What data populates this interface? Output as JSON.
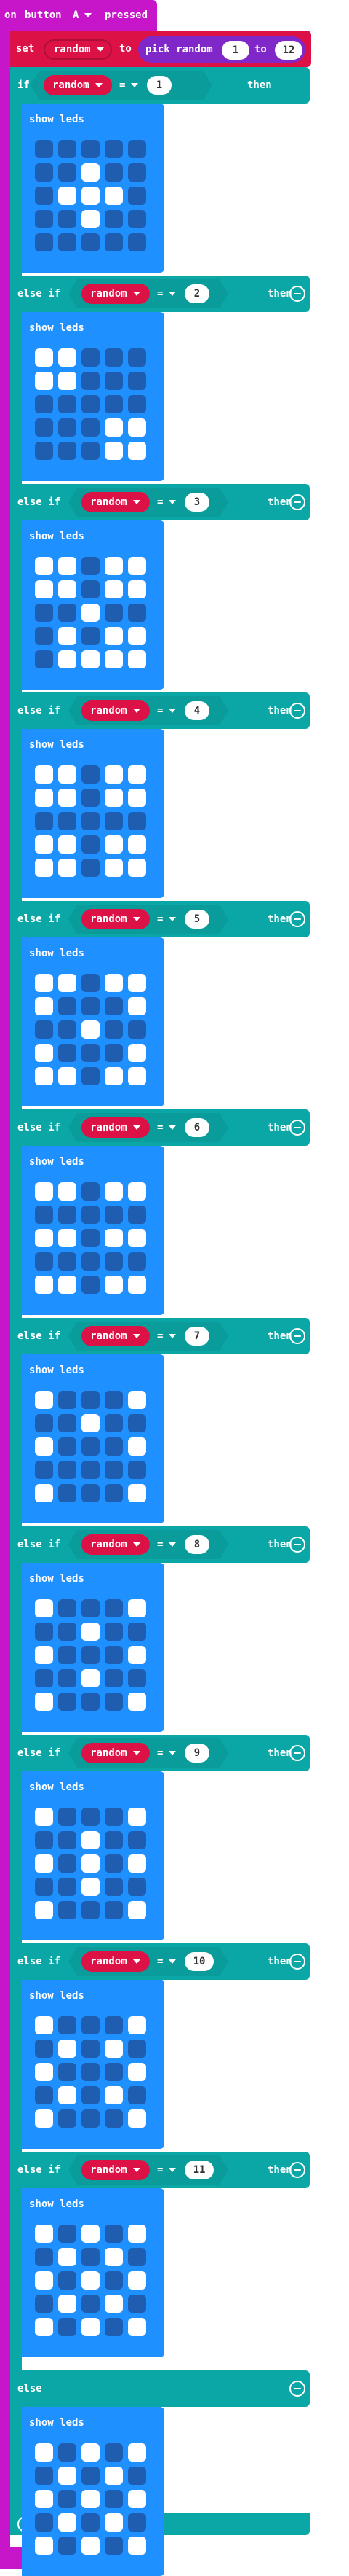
{
  "colors": {
    "event": "#c716c9",
    "logic": "#0ba7a7",
    "variable": "#dc1246",
    "math": "#7f27c9",
    "basic": "#1e90ff",
    "led_off": "#1e5db0",
    "led_on": "#ffffff"
  },
  "event_block": {
    "label_on": "on",
    "label_button": "button",
    "button_value": "A",
    "label_pressed": "pressed"
  },
  "set_block": {
    "label_set": "set",
    "variable": "random",
    "label_to": "to",
    "label_pick": "pick random",
    "min": "1",
    "label_range_to": "to",
    "max": "12"
  },
  "if_label": "if",
  "else_if_label": "else if",
  "else_label": "else",
  "then_label": "then",
  "show_leds_label": "show leds",
  "compare_op": "=",
  "cases": [
    {
      "keyword": "if",
      "variable": "random",
      "value": "1",
      "leds": [
        [
          0,
          0,
          0,
          0,
          0
        ],
        [
          0,
          0,
          1,
          0,
          0
        ],
        [
          0,
          1,
          1,
          1,
          0
        ],
        [
          0,
          0,
          1,
          0,
          0
        ],
        [
          0,
          0,
          0,
          0,
          0
        ]
      ]
    },
    {
      "keyword": "else if",
      "variable": "random",
      "value": "2",
      "leds": [
        [
          1,
          1,
          0,
          0,
          0
        ],
        [
          1,
          1,
          0,
          0,
          0
        ],
        [
          0,
          0,
          0,
          0,
          0
        ],
        [
          0,
          0,
          0,
          1,
          1
        ],
        [
          0,
          0,
          0,
          1,
          1
        ]
      ]
    },
    {
      "keyword": "else if",
      "variable": "random",
      "value": "3",
      "leds": [
        [
          1,
          1,
          0,
          1,
          1
        ],
        [
          1,
          1,
          0,
          1,
          1
        ],
        [
          0,
          0,
          1,
          0,
          0
        ],
        [
          0,
          1,
          0,
          1,
          1
        ],
        [
          0,
          1,
          1,
          1,
          1
        ]
      ]
    },
    {
      "keyword": "else if",
      "variable": "random",
      "value": "4",
      "leds": [
        [
          1,
          1,
          0,
          1,
          1
        ],
        [
          1,
          1,
          0,
          1,
          1
        ],
        [
          0,
          0,
          0,
          0,
          0
        ],
        [
          1,
          1,
          0,
          1,
          1
        ],
        [
          1,
          1,
          0,
          1,
          1
        ]
      ]
    },
    {
      "keyword": "else if",
      "variable": "random",
      "value": "5",
      "leds": [
        [
          1,
          1,
          0,
          1,
          1
        ],
        [
          1,
          0,
          0,
          0,
          1
        ],
        [
          0,
          0,
          1,
          0,
          0
        ],
        [
          1,
          0,
          0,
          0,
          1
        ],
        [
          1,
          1,
          0,
          1,
          1
        ]
      ]
    },
    {
      "keyword": "else if",
      "variable": "random",
      "value": "6",
      "leds": [
        [
          1,
          1,
          0,
          1,
          1
        ],
        [
          0,
          0,
          0,
          0,
          0
        ],
        [
          1,
          1,
          0,
          1,
          1
        ],
        [
          0,
          0,
          0,
          0,
          0
        ],
        [
          1,
          1,
          0,
          1,
          1
        ]
      ]
    },
    {
      "keyword": "else if",
      "variable": "random",
      "value": "7",
      "leds": [
        [
          1,
          0,
          0,
          0,
          1
        ],
        [
          0,
          0,
          1,
          0,
          0
        ],
        [
          1,
          0,
          0,
          0,
          1
        ],
        [
          0,
          0,
          0,
          0,
          0
        ],
        [
          1,
          0,
          0,
          0,
          1
        ]
      ]
    },
    {
      "keyword": "else if",
      "variable": "random",
      "value": "8",
      "leds": [
        [
          1,
          0,
          0,
          0,
          1
        ],
        [
          0,
          0,
          1,
          0,
          0
        ],
        [
          1,
          0,
          0,
          0,
          1
        ],
        [
          0,
          0,
          1,
          0,
          0
        ],
        [
          1,
          0,
          0,
          0,
          1
        ]
      ]
    },
    {
      "keyword": "else if",
      "variable": "random",
      "value": "9",
      "leds": [
        [
          1,
          0,
          0,
          0,
          1
        ],
        [
          0,
          0,
          1,
          0,
          0
        ],
        [
          1,
          0,
          1,
          0,
          1
        ],
        [
          0,
          0,
          1,
          0,
          0
        ],
        [
          1,
          0,
          0,
          0,
          1
        ]
      ]
    },
    {
      "keyword": "else if",
      "variable": "random",
      "value": "10",
      "leds": [
        [
          1,
          0,
          0,
          0,
          1
        ],
        [
          0,
          1,
          0,
          1,
          0
        ],
        [
          1,
          0,
          0,
          0,
          1
        ],
        [
          0,
          1,
          0,
          1,
          0
        ],
        [
          1,
          0,
          0,
          0,
          1
        ]
      ]
    },
    {
      "keyword": "else if",
      "variable": "random",
      "value": "11",
      "leds": [
        [
          1,
          0,
          1,
          0,
          1
        ],
        [
          0,
          1,
          0,
          1,
          0
        ],
        [
          1,
          0,
          1,
          0,
          1
        ],
        [
          0,
          1,
          0,
          1,
          0
        ],
        [
          1,
          0,
          1,
          0,
          1
        ]
      ]
    },
    {
      "keyword": "else",
      "leds": [
        [
          1,
          0,
          1,
          0,
          1
        ],
        [
          0,
          1,
          0,
          1,
          0
        ],
        [
          1,
          0,
          1,
          0,
          1
        ],
        [
          0,
          1,
          0,
          1,
          0
        ],
        [
          1,
          0,
          1,
          0,
          1
        ]
      ]
    }
  ]
}
